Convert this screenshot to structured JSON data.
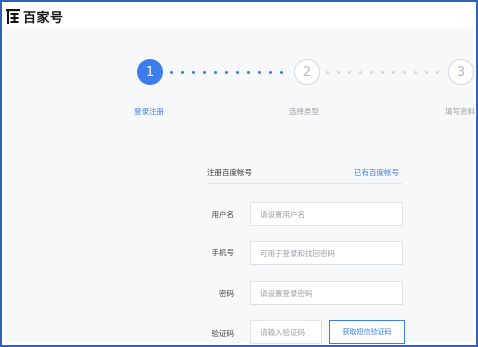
{
  "brand": {
    "name": "百家号"
  },
  "steps": [
    {
      "number": "1",
      "label": "登录注册",
      "active": true
    },
    {
      "number": "2",
      "label": "选择类型",
      "active": false
    },
    {
      "number": "3",
      "label": "填写资料",
      "active": false
    }
  ],
  "form": {
    "title": "注册百度帐号",
    "login_link": "已有百度帐号",
    "fields": [
      {
        "label": "用户名",
        "placeholder": "请设置用户名"
      },
      {
        "label": "手机号",
        "placeholder": "可用于登录和找回密码"
      },
      {
        "label": "密码",
        "placeholder": "请设置登录密码"
      },
      {
        "label": "验证码",
        "placeholder": "请输入验证码"
      }
    ],
    "sms_button": "获取短信验证码"
  },
  "colors": {
    "accent": "#3b7ded",
    "frame_border": "#2e63b6",
    "inactive": "#d4d8de",
    "background": "#f7f8fa"
  }
}
